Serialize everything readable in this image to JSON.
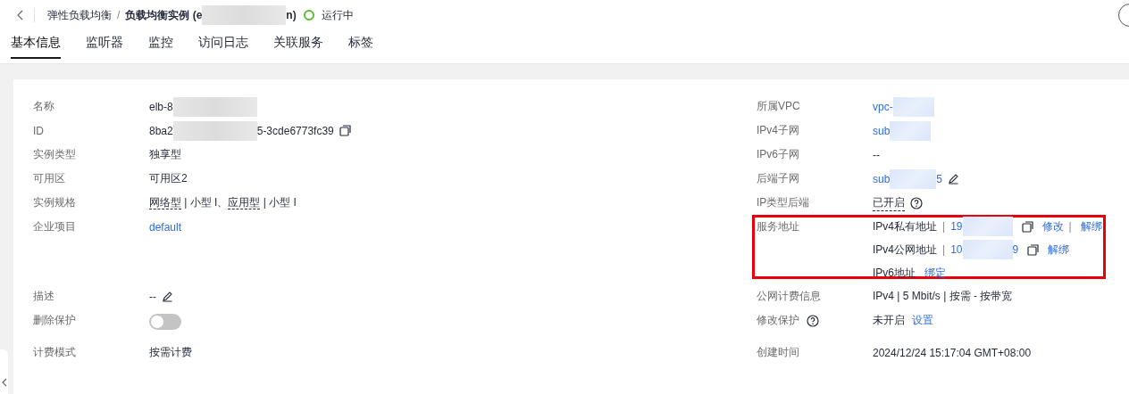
{
  "header": {
    "breadcrumb": "弹性负载均衡",
    "separator": "/",
    "title_start": "负载均衡实例 (e",
    "title_end": "n)",
    "status": "运行中"
  },
  "tabs": [
    {
      "label": "基本信息",
      "selected": true
    },
    {
      "label": "监听器",
      "selected": false
    },
    {
      "label": "监控",
      "selected": false
    },
    {
      "label": "访问日志",
      "selected": false
    },
    {
      "label": "关联服务",
      "selected": false
    },
    {
      "label": "标签",
      "selected": false
    }
  ],
  "left_fields": [
    {
      "kind": "redacted",
      "label": "名称",
      "value": "elb-8"
    },
    {
      "kind": "redacted",
      "label": "ID",
      "value": "8ba2",
      "value_end": "5-3cde6773fc39",
      "copyable": true
    },
    {
      "kind": "text",
      "label": "实例类型",
      "value": "独享型"
    },
    {
      "kind": "text",
      "label": "可用区",
      "value": "可用区2"
    },
    {
      "kind": "spec",
      "label": "实例规格",
      "parts": [
        {
          "text": "网络型",
          "term": true
        },
        {
          "text": " | 小型 I、"
        },
        {
          "text": "应用型",
          "term": true
        },
        {
          "text": " | 小型 I"
        }
      ]
    },
    {
      "kind": "link",
      "label": "企业项目",
      "value": "default"
    },
    {
      "kind": "edit",
      "label": "描述",
      "value": "--"
    },
    {
      "kind": "toggle",
      "label": "删除保护",
      "on": false
    },
    {
      "kind": "text",
      "label": "计费模式",
      "value": "按需计费"
    }
  ],
  "right_fields": [
    {
      "kind": "redacted_link",
      "label": "所属VPC",
      "value": "vpc-"
    },
    {
      "kind": "redacted_link",
      "label": "IPv4子网",
      "value": "sub"
    },
    {
      "kind": "text",
      "label": "IPv6子网",
      "value": "--"
    },
    {
      "kind": "redacted_link",
      "label": "后端子网",
      "value": "sub",
      "value_end": "5",
      "editable": true
    },
    {
      "kind": "term_help",
      "label": "IP类型后端",
      "value": "已开启"
    },
    {
      "kind": "address",
      "label": "服务地址",
      "highlighted": true,
      "lines": [
        {
          "label": "IPv4私有地址",
          "divider": "|",
          "value": "19",
          "copyable": true,
          "actions": [
            "修改",
            "解绑"
          ],
          "action_divider": "|"
        },
        {
          "label": "IPv4公网地址",
          "divider": "|",
          "value": "10",
          "value_end": "9",
          "copyable": true,
          "actions": [
            "解绑"
          ]
        },
        {
          "label": "IPv6地址",
          "actions": [
            "绑定"
          ]
        }
      ]
    },
    {
      "kind": "text",
      "label": "公网计费信息",
      "value": "IPv4 | 5 Mbit/s | 按需 - 按带宽"
    },
    {
      "kind": "setting",
      "label": "修改保护",
      "value": "未开启",
      "action": "设置"
    },
    {
      "kind": "text",
      "label": "创建时间",
      "value": "2024/12/24 15:17:04 GMT+08:00"
    }
  ]
}
